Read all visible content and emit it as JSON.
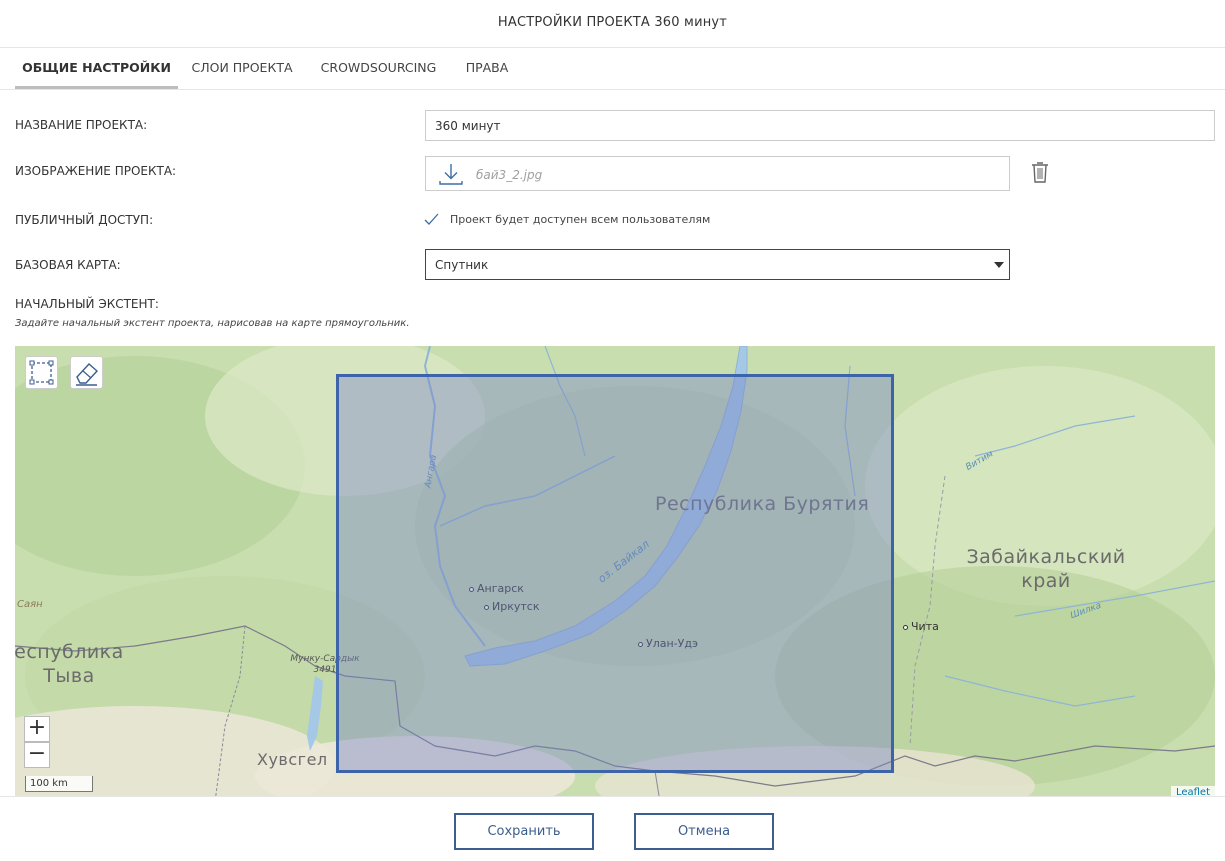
{
  "dialog": {
    "title": "НАСТРОЙКИ ПРОЕКТА 360 минут"
  },
  "tabs": [
    {
      "label": "ОБЩИЕ НАСТРОЙКИ",
      "active": true
    },
    {
      "label": "СЛОИ ПРОЕКТА",
      "active": false
    },
    {
      "label": "CROWDSOURCING",
      "active": false
    },
    {
      "label": "ПРАВА",
      "active": false
    }
  ],
  "form": {
    "name_label": "НАЗВАНИЕ ПРОЕКТА:",
    "name_value": "360 минут",
    "image_label": "ИЗОБРАЖЕНИЕ ПРОЕКТА:",
    "image_file": "бай3_2.jpg",
    "public_label": "ПУБЛИЧНЫЙ ДОСТУП:",
    "public_checked": true,
    "public_text": "Проект будет доступен всем пользователям",
    "basemap_label": "БАЗОВАЯ КАРТА:",
    "basemap_value": "Спутник",
    "extent_label": "НАЧАЛЬНЫЙ ЭКСТЕНТ:",
    "extent_hint": "Задайте начальный экстент проекта, нарисовав на карте прямоугольник."
  },
  "map": {
    "regions": [
      "Республика Бурятия",
      "Забайкальский край",
      "еспублика Тыва",
      "Хувсгел"
    ],
    "cities": [
      "Ангарск",
      "Иркутск",
      "Улан-Удэ",
      "Чита"
    ],
    "features": [
      "оз. Байкал",
      "Ангара",
      "Мунку-Сардык 3491",
      "Саян",
      "Витим",
      "Шилка"
    ],
    "scale_text": "100 km",
    "attribution": "Leaflet",
    "zoom_in": "+",
    "zoom_out": "−",
    "colors": {
      "extent_border": "#3d63a8",
      "extent_fill": "#7882c8",
      "land": "#c9deae",
      "water": "#a4c8e6"
    }
  },
  "buttons": {
    "save": "Сохранить",
    "cancel": "Отмена"
  },
  "colors": {
    "accent": "#3c5d8f"
  }
}
